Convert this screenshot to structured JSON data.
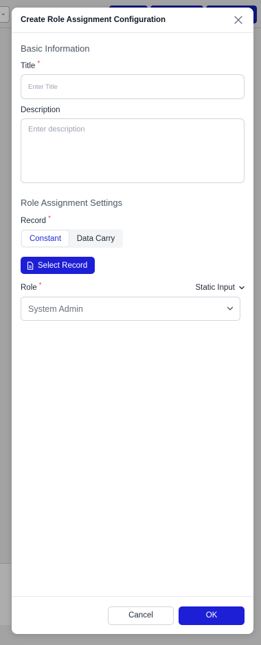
{
  "modal": {
    "title": "Create Role Assignment Configuration"
  },
  "basic_info": {
    "section_title": "Basic Information",
    "title_label": "Title",
    "title_placeholder": "Enter Title",
    "title_value": "",
    "description_label": "Description",
    "description_placeholder": "Enter description",
    "description_value": ""
  },
  "role_settings": {
    "section_title": "Role Assignment Settings",
    "record_label": "Record",
    "record_modes": [
      "Constant",
      "Data Carry"
    ],
    "record_mode_selected": "Constant",
    "select_record_button": "Select Record",
    "role_label": "Role",
    "role_input_mode": "Static Input",
    "role_selected": "System Admin"
  },
  "footer": {
    "cancel_label": "Cancel",
    "ok_label": "OK"
  },
  "colors": {
    "primary": "#1d1fd6",
    "required": "#ef4444",
    "backdrop": "#a3a3a3"
  },
  "icons": [
    "close-icon",
    "document-icon",
    "chevron-down-icon"
  ]
}
